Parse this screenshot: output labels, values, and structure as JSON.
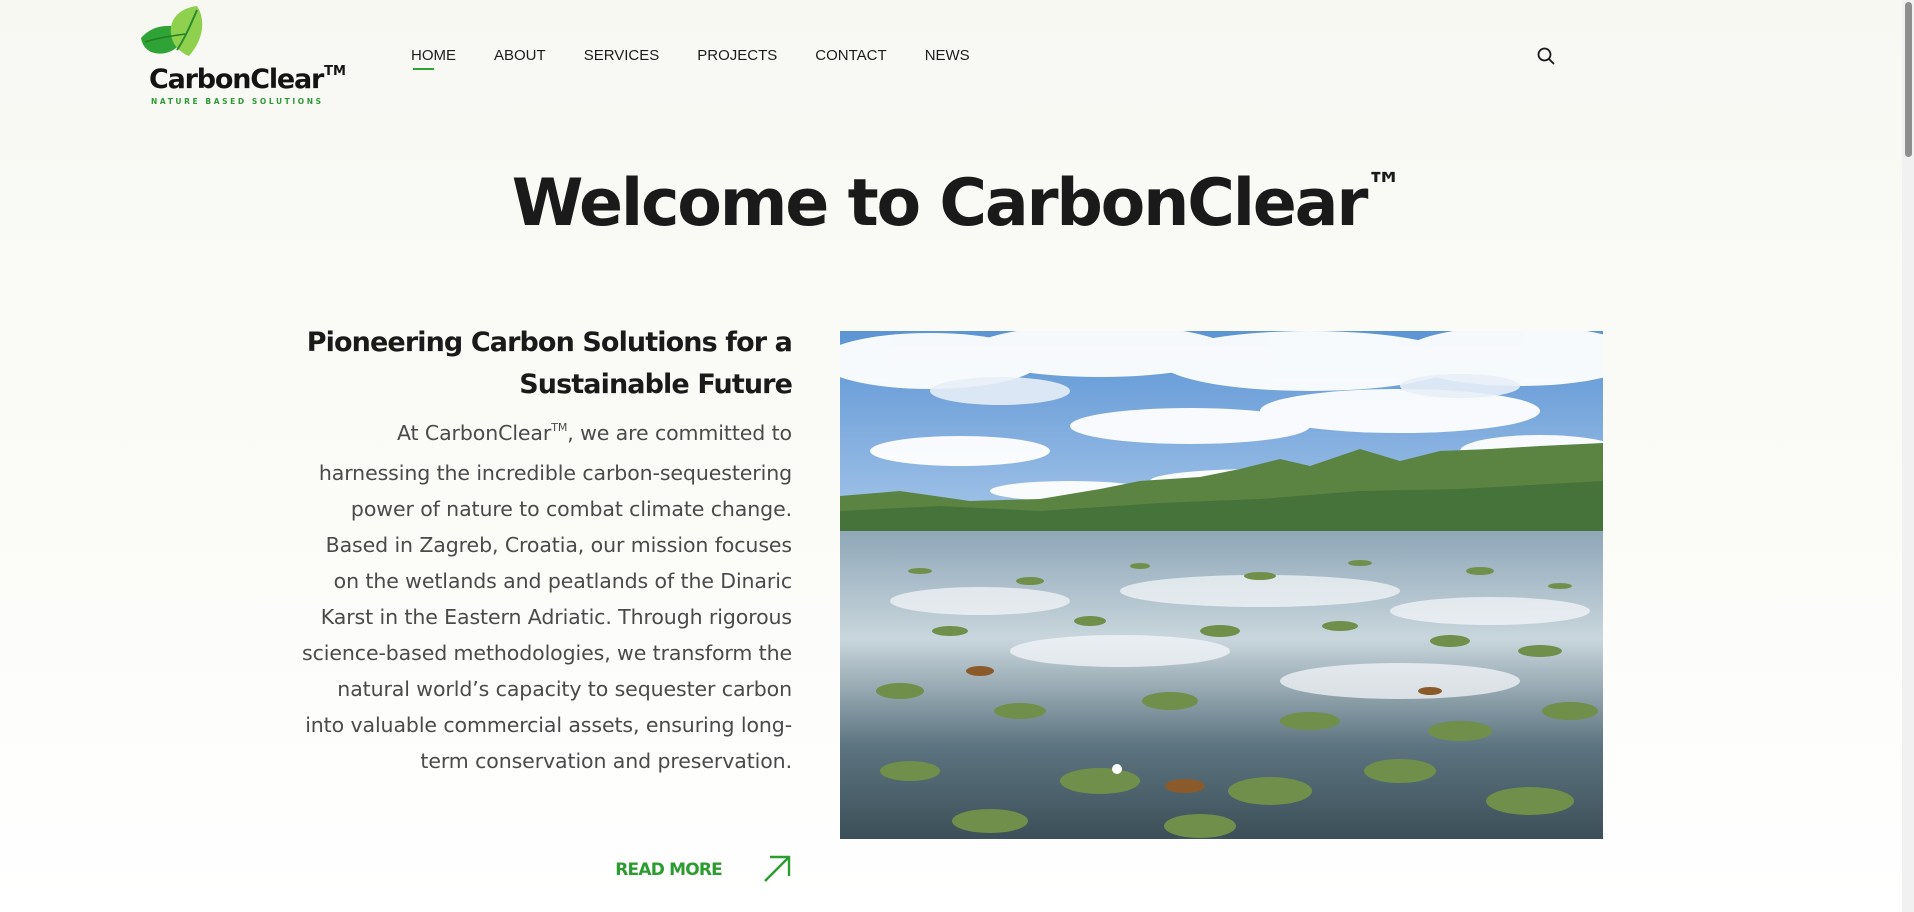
{
  "brand": {
    "name": "CarbonClear",
    "trademark": "TM",
    "tagline": "NATURE BASED SOLUTIONS",
    "accent_color": "#2fa335"
  },
  "nav": {
    "items": [
      {
        "label": "HOME",
        "active": true
      },
      {
        "label": "ABOUT",
        "active": false
      },
      {
        "label": "SERVICES",
        "active": false
      },
      {
        "label": "PROJECTS",
        "active": false
      },
      {
        "label": "CONTACT",
        "active": false
      },
      {
        "label": "NEWS",
        "active": false
      }
    ],
    "search_icon": "search-icon"
  },
  "hero": {
    "title": "Welcome to CarbonClear",
    "title_mark": "™"
  },
  "intro": {
    "heading_line1": "Pioneering Carbon Solutions for a",
    "heading_line2": "Sustainable Future",
    "body_pre": "At CarbonClear",
    "body_tm": "TM",
    "body_post": ", we are committed to harnessing the incredible carbon-sequestering power of nature to combat climate change. Based in Zagreb, Croatia, our mission focuses on the wetlands and peatlands of the Dinaric Karst in the Eastern Adriatic. Through rigorous science-based methodologies, we transform the natural world’s capacity to sequester carbon into valuable commercial assets, ensuring long-term conservation and preservation.",
    "read_more_label": "READ MORE",
    "read_more_icon": "arrow-up-right-icon"
  },
  "image": {
    "icon": "wetland-lake-photo"
  }
}
